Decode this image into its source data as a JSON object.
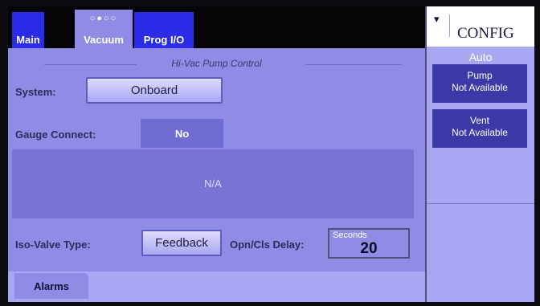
{
  "tabs": {
    "main": "Main",
    "vacuum": "Vacuum",
    "prog_io": "Prog I/O",
    "dots": "○●○○"
  },
  "section_title": "Hi-Vac Pump Control",
  "system": {
    "label": "System:",
    "value": "Onboard"
  },
  "gauge": {
    "label": "Gauge Connect:",
    "value": "No"
  },
  "status_panel": "N/A",
  "iso_valve": {
    "label": "Iso-Valve Type:",
    "value": "Feedback"
  },
  "delay": {
    "label": "Opn/Cls Delay:",
    "unit": "Seconds",
    "value": "20"
  },
  "alarms": "Alarms",
  "config": {
    "title": "CONFIG",
    "chevron": "▾",
    "mode": "Auto",
    "pump": {
      "name": "Pump",
      "status": "Not Available"
    },
    "vent": {
      "name": "Vent",
      "status": "Not Available"
    }
  }
}
